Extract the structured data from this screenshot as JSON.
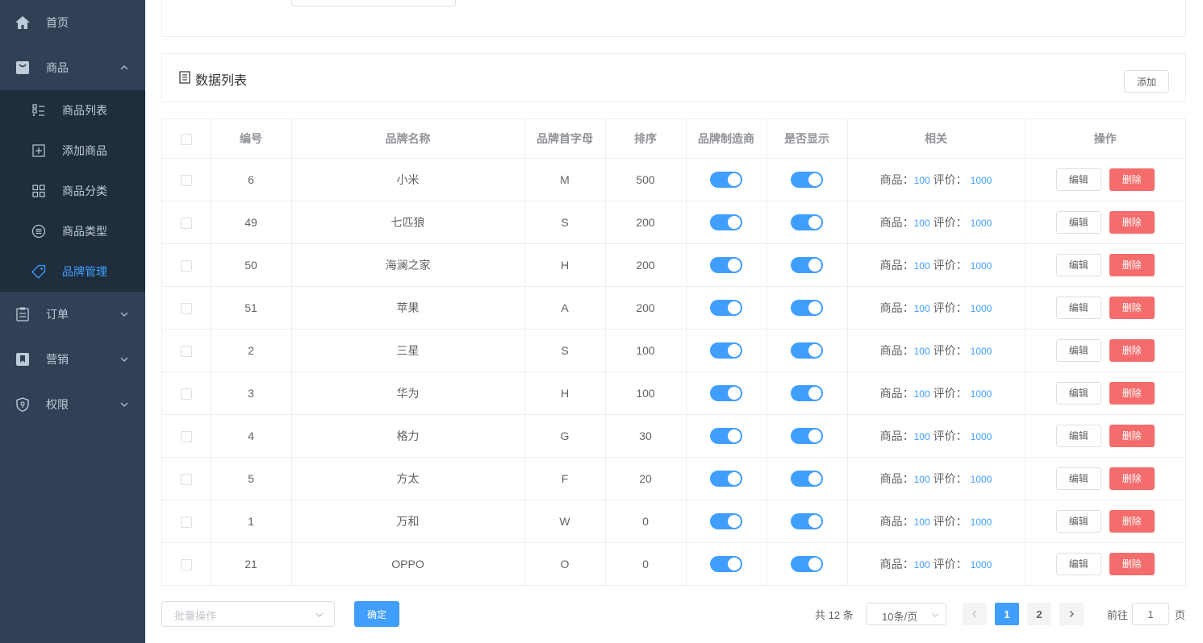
{
  "sidebar": {
    "home": {
      "label": "首页",
      "icon": "home-icon"
    },
    "goods": {
      "label": "商品",
      "icon": "shopping-bag-icon"
    },
    "goods_sub": [
      {
        "label": "商品列表",
        "icon": "list-icon"
      },
      {
        "label": "添加商品",
        "icon": "add-box-icon"
      },
      {
        "label": "商品分类",
        "icon": "grid-icon"
      },
      {
        "label": "商品类型",
        "icon": "circle-list-icon"
      },
      {
        "label": "品牌管理",
        "icon": "tag-icon",
        "active": true
      }
    ],
    "order": {
      "label": "订单",
      "icon": "clipboard-icon"
    },
    "marketing": {
      "label": "营销",
      "icon": "bookmark-icon"
    },
    "permission": {
      "label": "权限",
      "icon": "shield-icon"
    }
  },
  "list_header": {
    "title": "数据列表",
    "add_label": "添加"
  },
  "table": {
    "columns": [
      "编号",
      "品牌名称",
      "品牌首字母",
      "排序",
      "品牌制造商",
      "是否显示",
      "相关",
      "操作"
    ],
    "related_goods_label": "商品：",
    "related_comment_label": "评价：",
    "edit_label": "编辑",
    "delete_label": "删除",
    "rows": [
      {
        "id": "6",
        "name": "小米",
        "letter": "M",
        "sort": "500",
        "goods": "100",
        "comments": "1000"
      },
      {
        "id": "49",
        "name": "七匹狼",
        "letter": "S",
        "sort": "200",
        "goods": "100",
        "comments": "1000"
      },
      {
        "id": "50",
        "name": "海澜之家",
        "letter": "H",
        "sort": "200",
        "goods": "100",
        "comments": "1000"
      },
      {
        "id": "51",
        "name": "苹果",
        "letter": "A",
        "sort": "200",
        "goods": "100",
        "comments": "1000"
      },
      {
        "id": "2",
        "name": "三星",
        "letter": "S",
        "sort": "100",
        "goods": "100",
        "comments": "1000"
      },
      {
        "id": "3",
        "name": "华为",
        "letter": "H",
        "sort": "100",
        "goods": "100",
        "comments": "1000"
      },
      {
        "id": "4",
        "name": "格力",
        "letter": "G",
        "sort": "30",
        "goods": "100",
        "comments": "1000"
      },
      {
        "id": "5",
        "name": "方太",
        "letter": "F",
        "sort": "20",
        "goods": "100",
        "comments": "1000"
      },
      {
        "id": "1",
        "name": "万和",
        "letter": "W",
        "sort": "0",
        "goods": "100",
        "comments": "1000"
      },
      {
        "id": "21",
        "name": "OPPO",
        "letter": "O",
        "sort": "0",
        "goods": "100",
        "comments": "1000"
      }
    ]
  },
  "footer": {
    "batch_placeholder": "批量操作",
    "confirm_label": "确定",
    "total": "共 12 条",
    "page_size": "10条/页",
    "pages": [
      "1",
      "2"
    ],
    "current_page": "1",
    "goto_prefix": "前往",
    "goto_value": "1",
    "goto_suffix": "页"
  },
  "colors": {
    "sidebar_bg": "#304156",
    "submenu_bg": "#1f2d3d",
    "accent": "#409eff",
    "danger": "#f56c6c"
  }
}
